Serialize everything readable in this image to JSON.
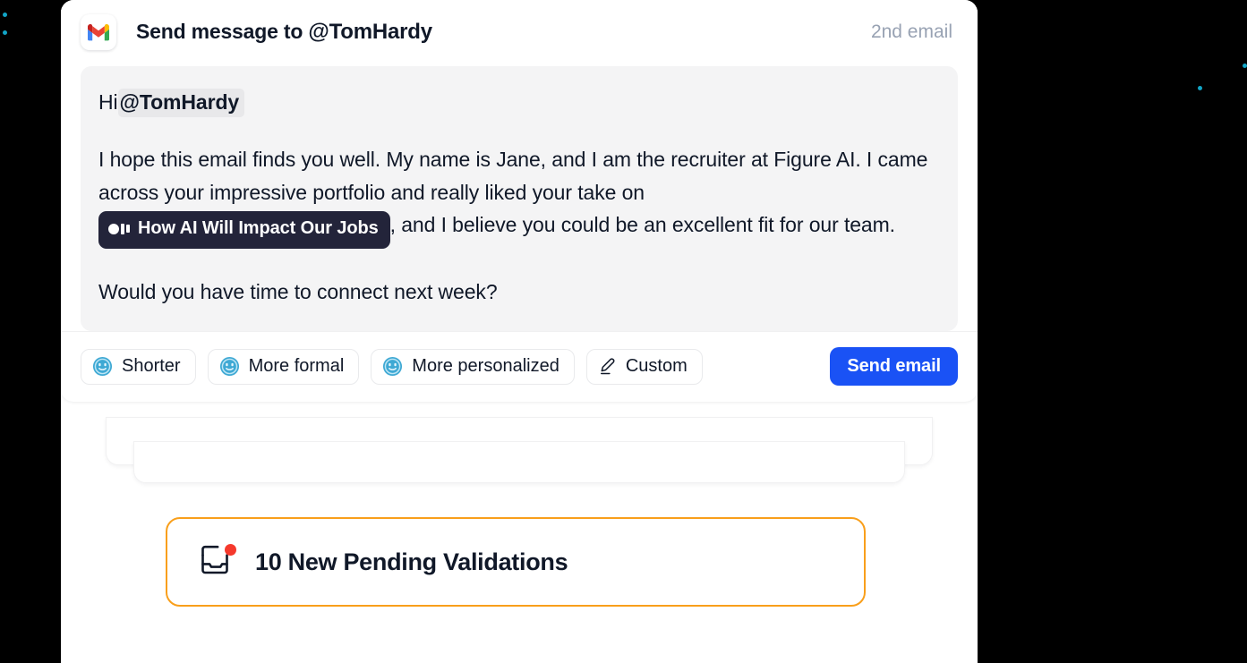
{
  "header": {
    "app_icon": "gmail-icon",
    "title_prefix": "Send message to",
    "recipient_handle": "@TomHardy",
    "sequence_label": "2nd email"
  },
  "message": {
    "greeting_prefix": "Hi",
    "greeting_mention": "@TomHardy",
    "paragraph_1_before_chip": "I hope this email finds you well. My name is Jane, and I am the recruiter at Figure AI. I came across your impressive portfolio and really liked your take on ",
    "topic_chip_label": "How AI Will Impact Our Jobs",
    "topic_chip_icon": "media-glyph-icon",
    "paragraph_1_after_chip": ", and I believe you could be an excellent fit for our team.",
    "paragraph_2": "Would you have time to connect next week?"
  },
  "toolbar": {
    "buttons": [
      {
        "label": "Shorter",
        "icon": "ai-face-icon"
      },
      {
        "label": "More formal",
        "icon": "ai-face-icon"
      },
      {
        "label": "More personalized",
        "icon": "ai-face-icon"
      },
      {
        "label": "Custom",
        "icon": "pencil-icon"
      }
    ],
    "send_label": "Send email"
  },
  "validations": {
    "icon": "inbox-icon",
    "badge": "notification-dot",
    "label": "10 New Pending Validations",
    "count": 10,
    "border_color": "#f99f1b"
  },
  "colors": {
    "backdrop": "#000000",
    "surface": "#ffffff",
    "message_panel": "#f4f4f5",
    "mention_highlight": "#e8e8ea",
    "topic_chip": "#23243a",
    "send_button": "#1a52f5",
    "accent_orange": "#f99f1b",
    "notification_red": "#f5392c",
    "sparkle": "#12a5c6",
    "muted_text": "#98a2b3"
  }
}
